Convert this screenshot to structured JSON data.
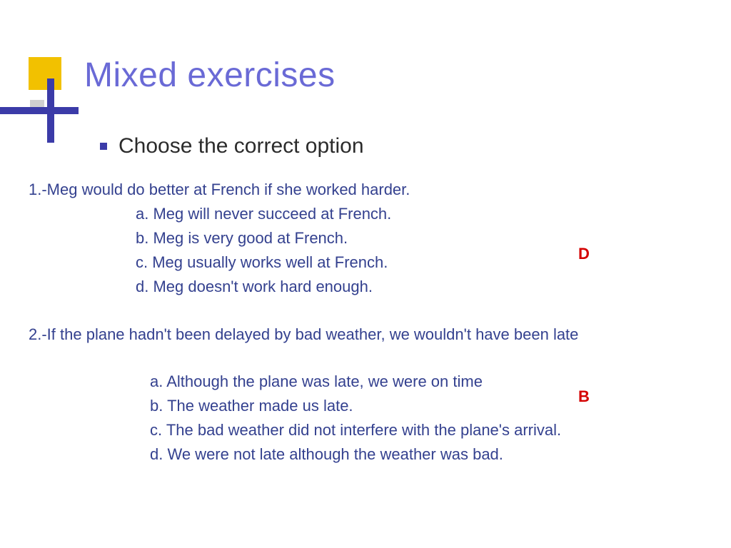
{
  "title": "Mixed exercises",
  "subtitle": "Choose the correct option",
  "q1": {
    "prompt": "1.-Meg would do better at French if she worked harder.",
    "a": "a. Meg will never succeed at French.",
    "b": "b. Meg is very good at French.",
    "c": "c. Meg usually works well at French.",
    "d": "d. Meg doesn't work hard enough.",
    "answer": "D"
  },
  "q2": {
    "prompt": "2.-If the plane hadn't been delayed by bad weather, we wouldn't have been late",
    "a": "a. Although the plane was late, we were on time",
    "b": "b. The weather made us late.",
    "c": " c. The bad weather did not interfere with the plane's arrival.",
    "d": "d. We were not late although the weather was bad.",
    "answer": "B"
  }
}
